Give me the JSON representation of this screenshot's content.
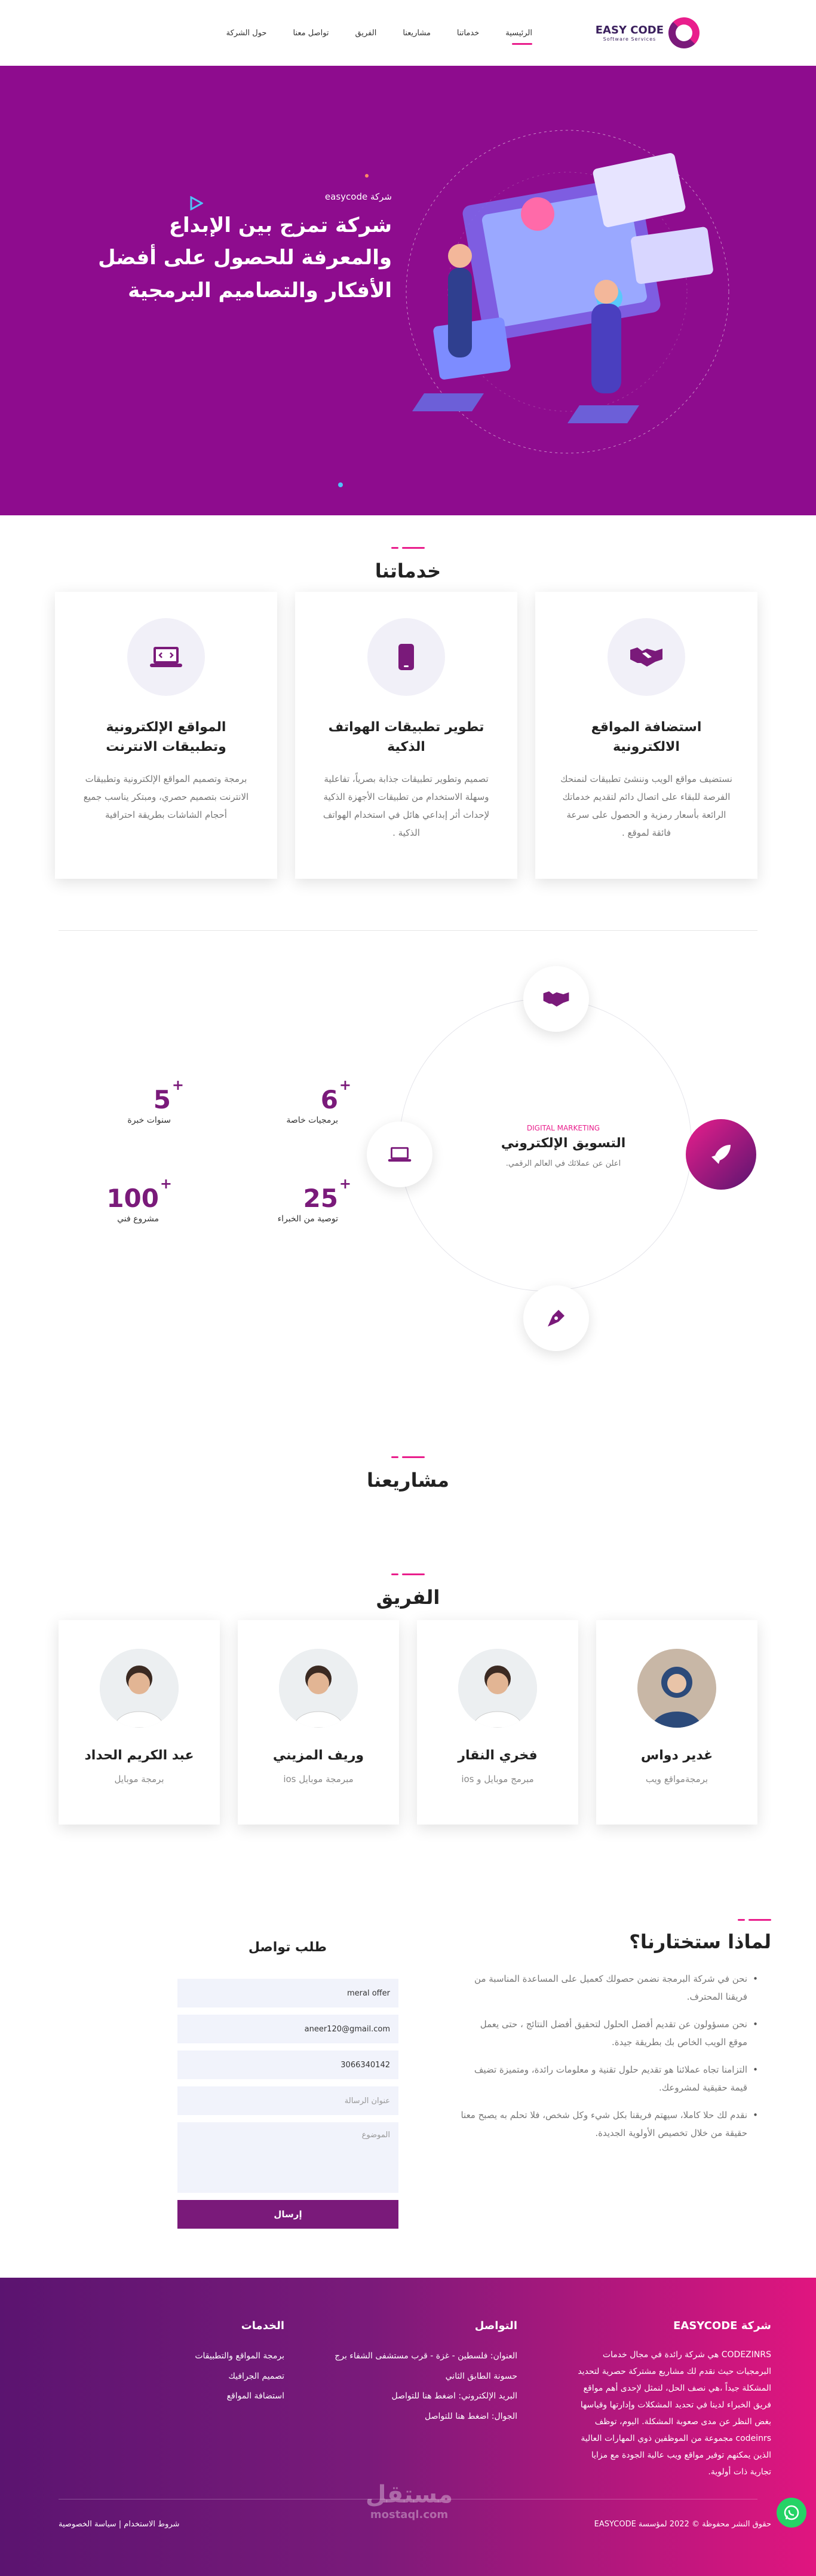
{
  "nav": {
    "brand_name": "EASY CODE",
    "brand_sub": "Software Services",
    "items": [
      "الرئيسية",
      "خدماتنا",
      "مشاريعنا",
      "الفريق",
      "تواصل معنا",
      "حول الشركة"
    ]
  },
  "hero": {
    "small": "شركة easycode",
    "title": "شركة تمزج بين الإبداع والمعرفة للحصول على أفضل الأفكار والتصاميم البرمجية"
  },
  "services": {
    "title": "خدماتنا",
    "cards": [
      {
        "title": "استضافة المواقع الالكترونية",
        "text": "نستضيف مواقع الويب وننشئ تطبيقات لنمنحك الفرصة للبقاء على اتصال دائم لتقديم خدماتك الرائعة بأسعار رمزية و الحصول على سرعة فائقة لموقع .",
        "icon": "handshake-icon"
      },
      {
        "title": "تطوير تطبيقات الهواتف الذكية",
        "text": "تصميم وتطوير تطبيقات جذابة بصرياً، تفاعلية وسهلة الاستخدام من تطبيقات الأجهزة الذكية لإحداث أثر إبداعي هائل في استخدام الهواتف الذكية .",
        "icon": "mobile-icon"
      },
      {
        "title": "المواقع الإلكترونية وتطبيقات الانترنت",
        "text": "برمجة وتصميم المواقع الإلكترونية وتطبيقات الانترنت بتصميم حصري، ومبتكر يناسب جميع أحجام الشاشات بطريقة احترافية",
        "icon": "laptop-code-icon"
      }
    ]
  },
  "marketing": {
    "small": "DIGITAL MARKETING",
    "title": "التسويق الإلكتروني",
    "desc": "اعلن عن عملائك في العالم الرقمي."
  },
  "stats": [
    {
      "num": "6",
      "label": "برمجيات خاصة"
    },
    {
      "num": "5",
      "label": "سنوات خبرة"
    },
    {
      "num": "25",
      "label": "توصية من الخبراء"
    },
    {
      "num": "100",
      "label": "مشروع فني"
    }
  ],
  "projects": {
    "title": "مشاريعنا"
  },
  "team": {
    "title": "الفريق",
    "members": [
      {
        "name": "غدير دواس",
        "role": "برمجةمواقع ويب"
      },
      {
        "name": "فخري النقار",
        "role": "مبرمج موبايل و ios"
      },
      {
        "name": "وريف المزيني",
        "role": "مبرمجة موبايل ios"
      },
      {
        "name": "عبد الكريم الحداد",
        "role": "برمجة موبايل"
      }
    ]
  },
  "why": {
    "title": "لماذا ستختارنا؟",
    "items": [
      "نحن في شركة البرمجة نضمن حصولك كعميل على المساعدة المناسبة من فريقنا المحترف.",
      "نحن مسؤولون عن تقديم أفضل الحلول لتحقيق أفضل النتائج ، حتى يعمل موقع الويب الخاص بك بطريقة جيدة.",
      "التزامنا تجاه عملائنا هو تقديم حلول تقنية و معلومات رائدة، ومتميزة تضيف قيمة حقيقية لمشروعك.",
      "نقدم لك حلا كاملا، سيهتم فريقنا بكل شيء وكل شخص، فلا تحلم به يصبح معنا حقيقة من خلال تخصيص الأولوية الجديدة."
    ]
  },
  "contact": {
    "title": "طلب تواصل",
    "name_value": "meral offer",
    "email_value": "aneer120@gmail.com",
    "phone_value": "3066340142",
    "address_placeholder": "عنوان الرسالة",
    "subject_placeholder": "الموضوع",
    "send_label": "إرسال"
  },
  "footer": {
    "about_title": "شركة EASYCODE",
    "about_text": "CODEZINRS هي شركة رائدة في مجال خدمات البرمجيات حيث نقدم لك مشاريع مشتركة حصرية لتحديد المشكلة جيداً ،هي نصف الحل، لنمثل لإحدى أهم مواقع فريق الخبراء لدينا في تحديد المشكلات وإدارتها وقياسها بغض النظر عن مدى صعوبة المشكلة. اليوم، توظف codeinrs مجموعة من الموظفين ذوي المهارات العالية الذين يمكنهم توفير مواقع ويب عالية الجودة مع مزايا تجارية ذات أولوية.",
    "contact_title": "التواصل",
    "contact_lines": [
      "العنوان: فلسطين - غزة - قرب مستشفى الشفاء برج حسونة الطابق الثاني",
      "البريد الإلكتروني: اضغط هنا للتواصل",
      "الجوال: اضغط هنا للتواصل"
    ],
    "services_title": "الخدمات",
    "services_links": [
      "برمجة المواقع والتطبيقات",
      "تصميم الجرافيك",
      "استضافة المواقع"
    ],
    "copyright": "حقوق النشر محفوظة © 2022 لمؤسسة EASYCODE",
    "bottom_links": "شروط الاستخدام | سياسة الخصوصية",
    "watermark": "مستقل",
    "watermark_sub": "mostaql.com"
  }
}
